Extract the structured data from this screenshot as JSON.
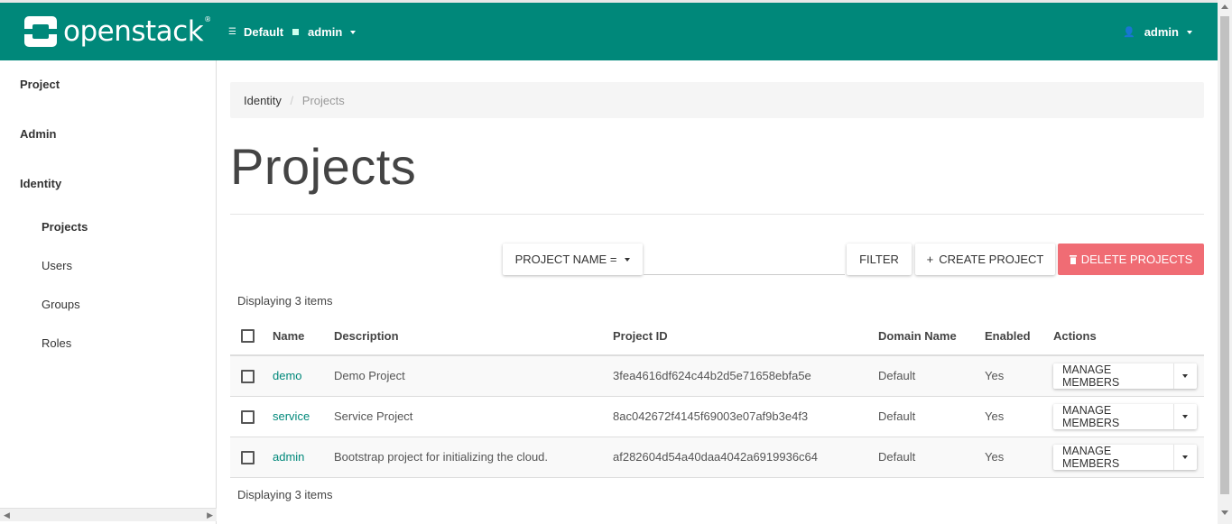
{
  "header": {
    "logo_text": "openstack",
    "logo_mark": "®",
    "domain": "Default",
    "project": "admin",
    "user": "admin"
  },
  "sidebar": {
    "items": [
      {
        "label": "Project"
      },
      {
        "label": "Admin"
      },
      {
        "label": "Identity"
      }
    ],
    "subitems": [
      {
        "label": "Projects",
        "active": true
      },
      {
        "label": "Users"
      },
      {
        "label": "Groups"
      },
      {
        "label": "Roles"
      }
    ]
  },
  "breadcrumb": {
    "parent": "Identity",
    "sep": "/",
    "current": "Projects"
  },
  "page_title": "Projects",
  "toolbar": {
    "filter_select": "PROJECT NAME =",
    "filter_value": "",
    "filter_button": "FILTER",
    "create_button": "CREATE PROJECT",
    "create_glyph": "+",
    "delete_button": "DELETE PROJECTS"
  },
  "table": {
    "count_text": "Displaying 3 items",
    "columns": [
      "Name",
      "Description",
      "Project ID",
      "Domain Name",
      "Enabled",
      "Actions"
    ],
    "rows": [
      {
        "name": "demo",
        "description": "Demo Project",
        "project_id": "3fea4616df624c44b2d5e71658ebfa5e",
        "domain": "Default",
        "enabled": "Yes",
        "action": "MANAGE MEMBERS"
      },
      {
        "name": "service",
        "description": "Service Project",
        "project_id": "8ac042672f4145f69003e07af9b3e4f3",
        "domain": "Default",
        "enabled": "Yes",
        "action": "MANAGE MEMBERS"
      },
      {
        "name": "admin",
        "description": "Bootstrap project for initializing the cloud.",
        "project_id": "af282604d54a40daa4042a6919936c64",
        "domain": "Default",
        "enabled": "Yes",
        "action": "MANAGE MEMBERS"
      }
    ]
  },
  "colors": {
    "brand": "#00887a",
    "danger": "#f06c74"
  },
  "icons": [
    "openstack-logo-icon",
    "domain-list-icon",
    "project-square-icon",
    "user-icon",
    "trash-icon",
    "plus-icon",
    "chevron-down-icon"
  ]
}
